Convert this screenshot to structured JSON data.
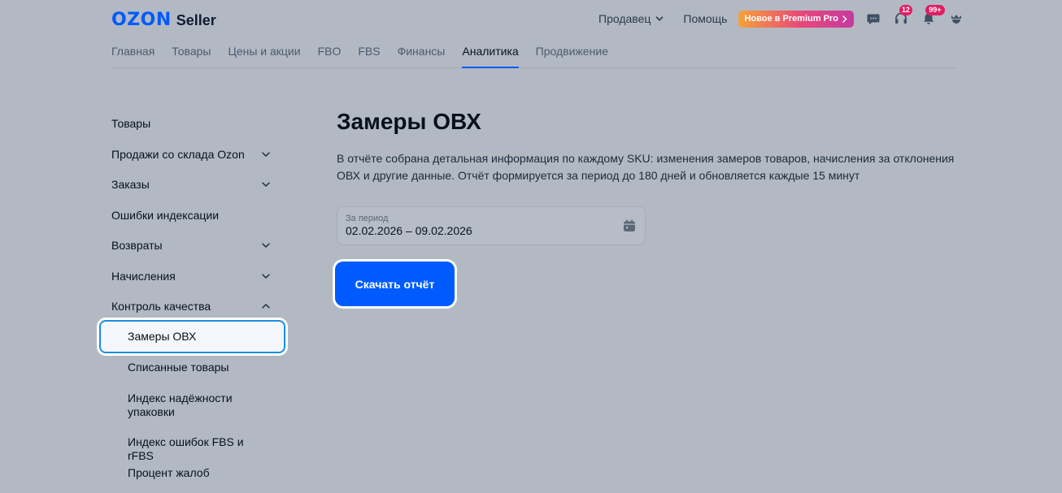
{
  "header": {
    "logo_brand": "OZON",
    "logo_product": "Seller",
    "seller_menu_label": "Продавец",
    "help_label": "Помощь",
    "premium_label": "Новое в Premium Pro",
    "support_badge": "12",
    "notifications_badge": "99+"
  },
  "nav": {
    "tabs": [
      "Главная",
      "Товары",
      "Цены и акции",
      "FBO",
      "FBS",
      "Финансы",
      "Аналитика",
      "Продвижение"
    ],
    "active_tab": "Аналитика"
  },
  "sidebar": {
    "items": [
      {
        "label": "Товары",
        "chevron": "none"
      },
      {
        "label": "Продажи со склада Ozon",
        "chevron": "down"
      },
      {
        "label": "Заказы",
        "chevron": "down"
      },
      {
        "label": "Ошибки индексации",
        "chevron": "none"
      },
      {
        "label": "Возвраты",
        "chevron": "down"
      },
      {
        "label": "Начисления",
        "chevron": "down"
      },
      {
        "label": "Контроль качества",
        "chevron": "up"
      }
    ],
    "subitems": [
      {
        "label": "Замеры ОВХ",
        "selected": true
      },
      {
        "label": "Списанные товары",
        "selected": false
      },
      {
        "label": "Индекс надёжности упаковки",
        "selected": false
      },
      {
        "label": "Индекс ошибок FBS и rFBS",
        "selected": false
      },
      {
        "label": "Процент жалоб",
        "selected": false
      }
    ]
  },
  "content": {
    "title": "Замеры ОВХ",
    "description": "В отчёте собрана детальная информация по каждому SKU: изменения замеров товаров, начисления за отклонения ОВХ и другие данные. Отчёт формируется за период до 180 дней и обновляется каждые 15 минут",
    "period_label": "За период",
    "period_value": "02.02.2026 – 09.02.2026",
    "download_label": "Скачать отчёт"
  },
  "colors": {
    "accent": "#005bff",
    "background_dimmed": "#b3b9c2",
    "badge": "#e11d64"
  }
}
